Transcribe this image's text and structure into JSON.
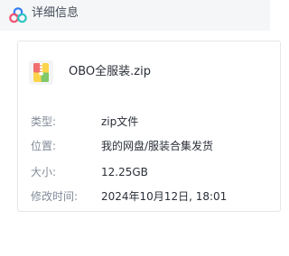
{
  "header": {
    "title": "详细信息",
    "icon": "cloud-logo-icon"
  },
  "file": {
    "name": "OBO全服装.zip",
    "icon": "zip-archive-icon"
  },
  "details": [
    {
      "label": "类型:",
      "value": "zip文件"
    },
    {
      "label": "位置:",
      "value": "我的网盘/服装合集发货"
    },
    {
      "label": "大小:",
      "value": "12.25GB"
    },
    {
      "label": "修改时间:",
      "value": "2024年10月12日, 18:01"
    }
  ],
  "colors": {
    "header_bg": "#f5f6f7",
    "border": "#e4e6ea",
    "label": "#838b98",
    "text": "#2a2f38",
    "logo_blue": "#2f7cf6",
    "logo_red": "#f0506e",
    "logo_yellow": "#f7b72e",
    "logo_teal": "#2bc4c2"
  }
}
